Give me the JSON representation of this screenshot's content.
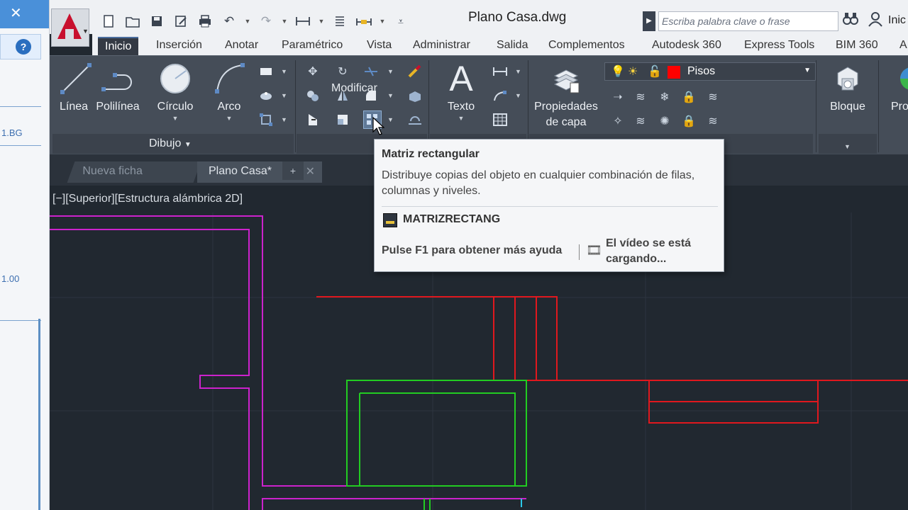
{
  "left_pane": {
    "close_glyph": "✕",
    "help_glyph": "?",
    "texts": [
      "1.BG",
      "1.00"
    ]
  },
  "title_bar": {
    "document_title": "Plano Casa.dwg",
    "search_placeholder": "Escriba palabra clave o frase",
    "user_label": "Inic"
  },
  "ribbon_tabs": [
    {
      "label": "Inicio",
      "active": true
    },
    {
      "label": "Inserción"
    },
    {
      "label": "Anotar"
    },
    {
      "label": "Paramétrico"
    },
    {
      "label": "Vista"
    },
    {
      "label": "Administrar"
    },
    {
      "label": "Salida"
    },
    {
      "label": "Complementos"
    },
    {
      "label": "Autodesk 360"
    },
    {
      "label": "Express Tools"
    },
    {
      "label": "BIM 360"
    },
    {
      "label": "A"
    }
  ],
  "draw_panel": {
    "title": "Dibujo",
    "tools": [
      {
        "label": "Línea",
        "icon": "line-icon"
      },
      {
        "label": "Polilínea",
        "icon": "polyline-icon"
      },
      {
        "label": "Círculo",
        "icon": "circle-icon"
      },
      {
        "label": "Arco",
        "icon": "arc-icon"
      }
    ]
  },
  "modify_panel": {
    "title": "Modificar"
  },
  "annotation_panel": {
    "text_label": "Texto",
    "glyph": "A"
  },
  "layers_panel": {
    "properties_label_1": "Propiedades",
    "properties_label_2": "de capa",
    "current_layer": "Pisos",
    "layer_color": "#ff0000"
  },
  "block_panel": {
    "label": "Bloque",
    "partial_label": "Pro"
  },
  "document_tabs": [
    {
      "label": "Nueva ficha",
      "active": false
    },
    {
      "label": "Plano Casa*",
      "active": true
    }
  ],
  "viewport": {
    "label": "[−][Superior][Estructura alámbrica 2D]"
  },
  "tooltip": {
    "title": "Matriz rectangular",
    "description": "Distribuye copias del objeto en cualquier combinación de filas, columnas y niveles.",
    "command": "MATRIZRECTANG",
    "help": "Pulse F1 para obtener más ayuda",
    "video": "El vídeo se está cargando..."
  },
  "colors": {
    "magenta": "#cc22cc",
    "red": "#e0181e",
    "green": "#22cc22",
    "canvas_bg": "#212830",
    "ribbon_bg": "#454d58"
  }
}
